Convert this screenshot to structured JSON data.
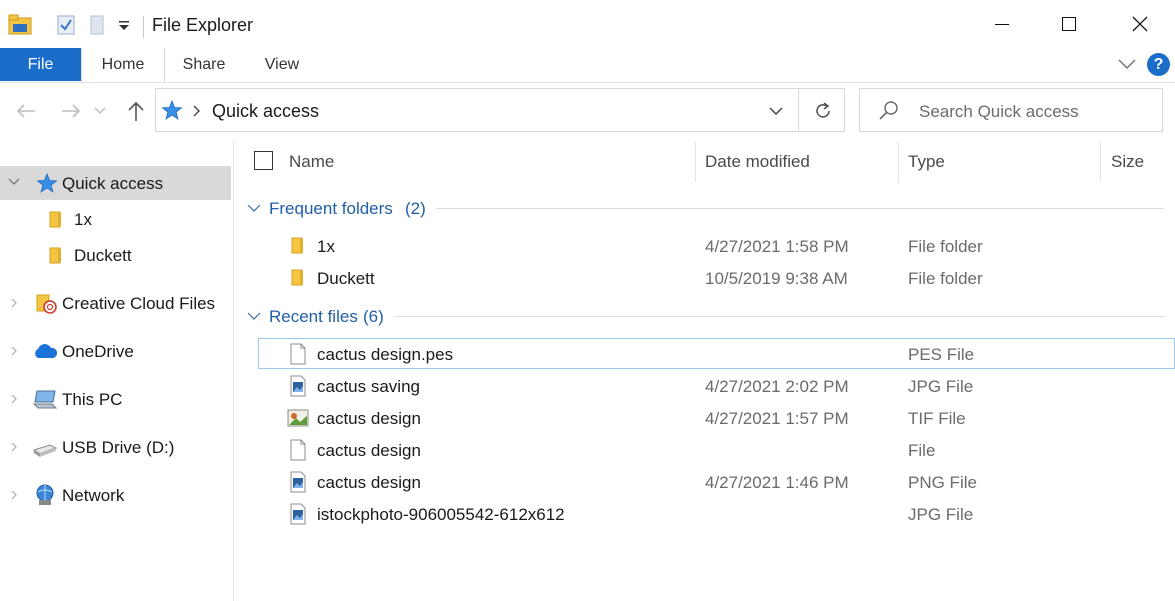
{
  "window": {
    "title": "File Explorer"
  },
  "ribbon": {
    "tabs": [
      "File",
      "Home",
      "Share",
      "View"
    ],
    "help_label": "?"
  },
  "address": {
    "location": "Quick access",
    "search_placeholder": "Search Quick access"
  },
  "nav_pane": {
    "items": [
      {
        "label": "Quick access",
        "icon": "star-icon",
        "selected": true
      },
      {
        "label": "1x",
        "icon": "folder-icon"
      },
      {
        "label": "Duckett",
        "icon": "folder-icon"
      },
      {
        "label": "Creative Cloud Files",
        "icon": "creative-cloud-folder-icon"
      },
      {
        "label": "OneDrive",
        "icon": "cloud-icon"
      },
      {
        "label": "This PC",
        "icon": "computer-icon"
      },
      {
        "label": "USB Drive (D:)",
        "icon": "usb-drive-icon"
      },
      {
        "label": "Network",
        "icon": "network-icon"
      }
    ]
  },
  "columns": [
    "Name",
    "Date modified",
    "Type",
    "Size"
  ],
  "groups": {
    "frequent": {
      "label": "Frequent folders",
      "count": "(2)",
      "items": [
        {
          "name": "1x",
          "date": "4/27/2021 1:58 PM",
          "type": "File folder",
          "icon": "folder-icon"
        },
        {
          "name": "Duckett",
          "date": "10/5/2019 9:38 AM",
          "type": "File folder",
          "icon": "folder-icon"
        }
      ]
    },
    "recent": {
      "label": "Recent files",
      "count": "(6)",
      "items": [
        {
          "name": "cactus design.pes",
          "date": "",
          "type": "PES File",
          "icon": "blank-file-icon"
        },
        {
          "name": "cactus saving",
          "date": "4/27/2021 2:02 PM",
          "type": "JPG File",
          "icon": "image-file-icon"
        },
        {
          "name": "cactus design",
          "date": "4/27/2021 1:57 PM",
          "type": "TIF File",
          "icon": "photo-file-icon"
        },
        {
          "name": "cactus design",
          "date": "",
          "type": "File",
          "icon": "blank-file-icon"
        },
        {
          "name": "cactus design",
          "date": "4/27/2021 1:46 PM",
          "type": "PNG File",
          "icon": "image-file-icon"
        },
        {
          "name": "istockphoto-906005542-612x612",
          "date": "",
          "type": "JPG File",
          "icon": "image-file-icon"
        }
      ]
    }
  },
  "colors": {
    "accent": "#1a6dc9",
    "group_text": "#1f5fa8",
    "selection": "#d9d9d9",
    "folder": "#f4c542"
  }
}
